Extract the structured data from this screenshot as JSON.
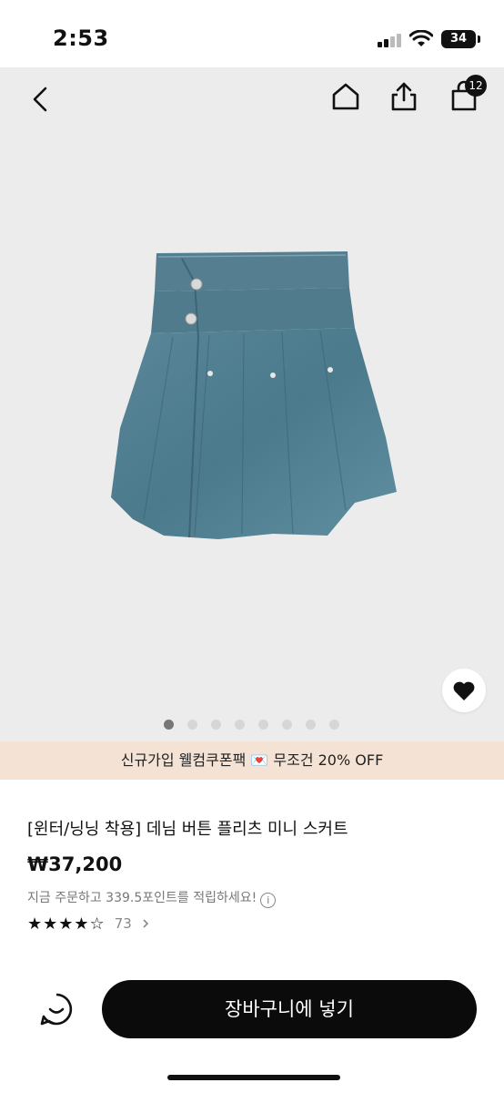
{
  "status_bar": {
    "time": "2:53",
    "battery": "34"
  },
  "header": {
    "cart_count": "12"
  },
  "gallery": {
    "active_index": 0,
    "total": 8
  },
  "promo": {
    "text": "신규가입 웰컴쿠폰팩 💌 무조건 20% OFF"
  },
  "product": {
    "title": "[윈터/닝닝 착용] 데님 버튼 플리츠 미니 스커트",
    "price": "₩37,200",
    "points_text": "지금 주문하고 339.5포인트를 적립하세요!",
    "rating": 4.5,
    "review_count": "73"
  },
  "actions": {
    "add_to_cart": "장바구니에 넣기"
  },
  "icons": [
    "back-icon",
    "home-icon",
    "share-icon",
    "shopping-bag-icon",
    "heart-icon",
    "info-icon",
    "chevron-right-icon",
    "chat-icon"
  ],
  "colors": {
    "accent": "#0b0b0b",
    "promo_bg": "#f4e3d5",
    "hero_bg": "#ececec"
  }
}
